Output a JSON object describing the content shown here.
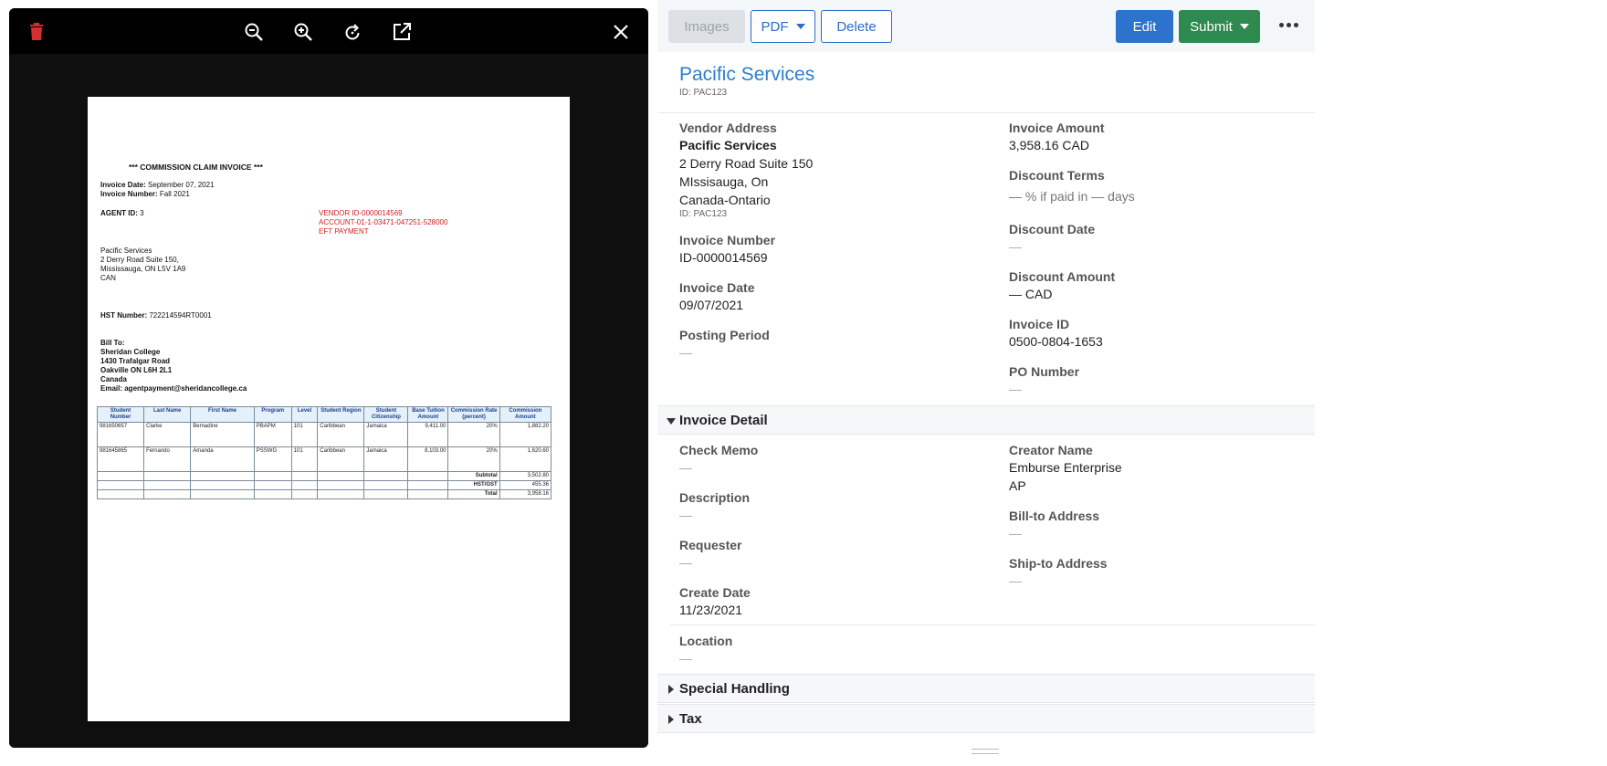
{
  "toolbar": {
    "images_label": "Images",
    "pdf_label": "PDF",
    "delete_label": "Delete",
    "edit_label": "Edit",
    "submit_label": "Submit"
  },
  "viewer": {
    "icons": [
      "trash-icon",
      "zoom-out-icon",
      "zoom-in-icon",
      "rotate-icon",
      "open-external-icon",
      "close-icon"
    ],
    "document": {
      "heading": "*** COMMISSION CLAIM INVOICE ***",
      "invoice_date_label": "Invoice Date:",
      "invoice_date": "September 07, 2021",
      "invoice_number_label": "Invoice Number:",
      "invoice_number": "Fall 2021",
      "agent_id_label": "AGENT ID:",
      "agent_id": "3",
      "vendor_id_line": "VENDOR ID-0000014569",
      "account_line": "ACCOUNT-01-1-03471-047251-528000",
      "payment_line": "EFT PAYMENT",
      "vendor_lines": [
        "Pacific Services",
        "2 Derry Road Suite 150,",
        "Mississauga, ON L5V 1A9",
        "CAN"
      ],
      "hst_label": "HST Number:",
      "hst_value": "722214594RT0001",
      "bill_to_lines": [
        "Bill To:",
        "Sheridan College",
        "1430 Trafalgar Road",
        "Oakville ON L6H 2L1",
        "Canada",
        "Email: agentpayment@sheridancollege.ca"
      ],
      "table_headers": [
        "Student Number",
        "Last Name",
        "First Name",
        "Program",
        "Level",
        "Student Region",
        "Student Citizenship",
        "Base Tuition Amount",
        "Commission Rate (percent)",
        "Commission Amount"
      ],
      "rows": [
        [
          "981650657",
          "Clarke",
          "Bernadine",
          "PBAPM",
          "101",
          "Caribbean",
          "Jamaica",
          "9,411.00",
          "20%",
          "1,882.20"
        ],
        [
          "981645865",
          "Fernando",
          "Amanda",
          "PSSWG",
          "101",
          "Caribbean",
          "Jamaica",
          "8,103.00",
          "20%",
          "1,620.60"
        ]
      ],
      "subtotal_label": "Subtotal",
      "subtotal": "3,502.80",
      "hst_gst_label": "HST/GST",
      "hst_gst": "455.36",
      "total_label": "Total",
      "total": "3,958.16"
    }
  },
  "vendor": {
    "name": "Pacific Services",
    "id": "ID: PAC123"
  },
  "fields": {
    "vendor_address_label": "Vendor Address",
    "vendor_address_name": "Pacific Services",
    "vendor_address_line1": "2 Derry Road Suite 150",
    "vendor_address_line2": "MIssisauga,  On",
    "vendor_address_line3": "Canada-Ontario",
    "vendor_address_id": "ID: PAC123",
    "invoice_number_label": "Invoice Number",
    "invoice_number": "ID-0000014569",
    "invoice_date_label": "Invoice Date",
    "invoice_date": "09/07/2021",
    "posting_period_label": "Posting Period",
    "posting_period": "—",
    "invoice_amount_label": "Invoice Amount",
    "invoice_amount": "3,958.16  CAD",
    "discount_terms_label": "Discount Terms",
    "discount_terms": "—  % if paid in  —  days",
    "discount_date_label": "Discount Date",
    "discount_date": "—",
    "discount_amount_label": "Discount Amount",
    "discount_amount": "—  CAD",
    "invoice_id_label": "Invoice ID",
    "invoice_id": "0500-0804-1653",
    "po_number_label": "PO Number",
    "po_number": "—"
  },
  "invoice_detail": {
    "title": "Invoice Detail",
    "check_memo_label": "Check Memo",
    "check_memo": "—",
    "description_label": "Description",
    "description": "—",
    "requester_label": "Requester",
    "requester": "—",
    "create_date_label": "Create Date",
    "create_date": "11/23/2021",
    "location_label": "Location",
    "location": "—",
    "creator_name_label": "Creator Name",
    "creator_name_line1": "Emburse Enterprise",
    "creator_name_line2": "AP",
    "bill_to_label": "Bill-to Address",
    "bill_to": "—",
    "ship_to_label": "Ship-to Address",
    "ship_to": "—"
  },
  "sections": {
    "special_handling": "Special Handling",
    "tax": "Tax"
  },
  "colors": {
    "primary": "#2b73cc",
    "success": "#2e8a4e",
    "link": "#2a7fcf",
    "danger": "#d32f2f"
  }
}
